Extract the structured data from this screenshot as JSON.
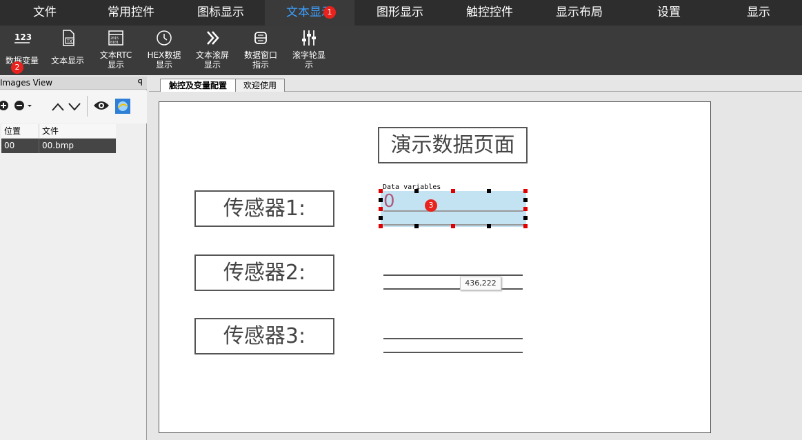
{
  "menu": {
    "items": [
      {
        "label": "文件"
      },
      {
        "label": "常用控件"
      },
      {
        "label": "图标显示"
      },
      {
        "label": "文本显示"
      },
      {
        "label": "图形显示"
      },
      {
        "label": "触控控件"
      },
      {
        "label": "显示布局"
      },
      {
        "label": "设置"
      },
      {
        "label": "显示"
      }
    ],
    "active_index": 3,
    "active_color": "#3ea0ff"
  },
  "annotations": {
    "badge1": "1",
    "badge2": "2",
    "badge3": "3"
  },
  "ribbon": {
    "items": [
      {
        "line1": "数据变量",
        "line2": "",
        "icon": "numeric-123-icon"
      },
      {
        "line1": "文本显示",
        "line2": "",
        "icon": "text-file-icon"
      },
      {
        "line1": "文本RTC",
        "line2": "显示",
        "icon": "calendar-rtc-icon"
      },
      {
        "line1": "HEX数据",
        "line2": "显示",
        "icon": "clock-icon"
      },
      {
        "line1": "文本滚屏",
        "line2": "显示",
        "icon": "double-chevron-icon"
      },
      {
        "line1": "数据窗口",
        "line2": "指示",
        "icon": "scroll-window-icon"
      },
      {
        "line1": "滚字轮显",
        "line2": "示",
        "icon": "sliders-icon"
      }
    ]
  },
  "images_view": {
    "title": "Images View",
    "pin": "ꟼ",
    "columns": [
      "位置",
      "文件"
    ],
    "rows": [
      {
        "pos": "00",
        "file": "00.bmp"
      }
    ]
  },
  "tabs": [
    {
      "label": "触控及变量配置"
    },
    {
      "label": "欢迎使用"
    }
  ],
  "canvas": {
    "title": "演示数据页面",
    "sensors": [
      {
        "label": "传感器1:"
      },
      {
        "label": "传感器2:"
      },
      {
        "label": "传感器3:"
      }
    ],
    "selected_widget": {
      "caption": "Data variables",
      "value": "0",
      "fill": "#c3e3f3"
    },
    "tooltip": "436,222"
  }
}
